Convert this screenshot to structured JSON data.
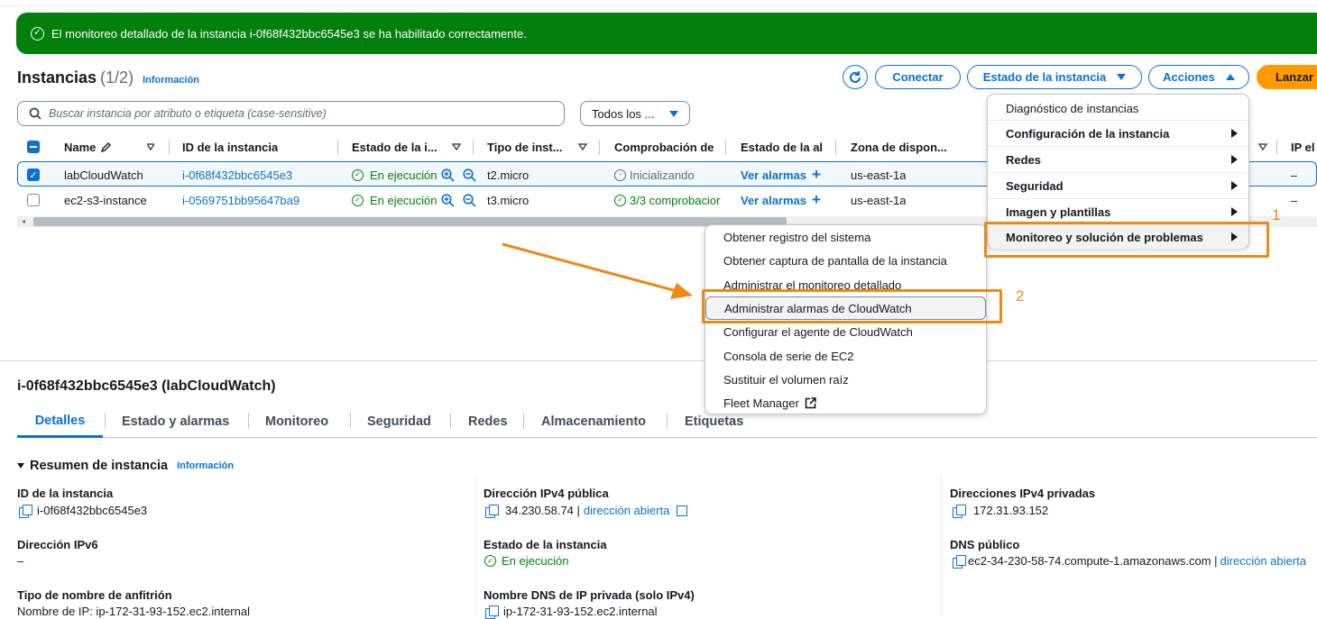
{
  "banner": {
    "text": "El monitoreo detallado de la instancia i-0f68f432bbc6545e3 se ha habilitado correctamente."
  },
  "header": {
    "title": "Instancias",
    "count": "(1/2)",
    "info": "Información"
  },
  "toolbar": {
    "refresh_icon": "refresh-icon",
    "connect": "Conectar",
    "instance_state": "Estado de la instancia",
    "actions": "Acciones",
    "launch": "Lanzar i"
  },
  "search": {
    "placeholder": "Buscar instancia por atributo o etiqueta (case-sensitive)"
  },
  "filter": {
    "value": "Todos los ..."
  },
  "table": {
    "headers": [
      "Name",
      "ID de la instancia",
      "Estado de la i...",
      "Tipo de inst...",
      "Comprobación de",
      "Estado de la al",
      "Zona de dispon...",
      "IP el"
    ],
    "rows": [
      {
        "name": "labCloudWatch",
        "id": "i-0f68f432bbc6545e3",
        "state": "En ejecución",
        "type": "t2.micro",
        "check": "Inicializando",
        "alarm": "Ver alarmas",
        "zone": "us-east-1a",
        "ip": "–",
        "selected": true
      },
      {
        "name": "ec2-s3-instance",
        "id": "i-0569751bb95647ba9",
        "state": "En ejecución",
        "type": "t3.micro",
        "check": "3/3 comprobacior",
        "alarm": "Ver alarmas",
        "zone": "us-east-1a",
        "ip": "–",
        "selected": false
      }
    ]
  },
  "actions_menu": [
    {
      "label": "Diagnóstico de instancias",
      "submenu": false,
      "bold": false
    },
    {
      "label": "Configuración de la instancia",
      "submenu": true,
      "bold": true
    },
    {
      "label": "Redes",
      "submenu": true,
      "bold": true
    },
    {
      "label": "Seguridad",
      "submenu": true,
      "bold": true
    },
    {
      "label": "Imagen y plantillas",
      "submenu": true,
      "bold": true
    },
    {
      "label": "Monitoreo y solución de problemas",
      "submenu": true,
      "bold": true
    }
  ],
  "submenu": [
    "Obtener registro del sistema",
    "Obtener captura de pantalla de la instancia",
    "Administrar el monitoreo detallado",
    "Administrar alarmas de CloudWatch",
    "Configurar el agente de CloudWatch",
    "Consola de serie de EC2",
    "Sustituir el volumen raíz",
    "Fleet Manager"
  ],
  "annotations": {
    "one": "1",
    "two": "2"
  },
  "details": {
    "title": "i-0f68f432bbc6545e3 (labCloudWatch)",
    "tabs": [
      "Detalles",
      "Estado y alarmas",
      "Monitoreo",
      "Seguridad",
      "Redes",
      "Almacenamiento",
      "Etiquetas"
    ],
    "summary": "Resumen de instancia",
    "summary_info": "Información",
    "fields": {
      "instance_id_label": "ID de la instancia",
      "instance_id": "i-0f68f432bbc6545e3",
      "ipv6_label": "Dirección IPv6",
      "ipv6": "–",
      "hostname_label": "Tipo de nombre de anfitrión",
      "hostname": "Nombre de IP: ip-172-31-93-152.ec2.internal",
      "public_ipv4_label": "Dirección IPv4 pública",
      "public_ipv4": "34.230.58.74 |",
      "open_address": "dirección abierta",
      "state_label": "Estado de la instancia",
      "state": "En ejecución",
      "private_dns_label": "Nombre DNS de IP privada (solo IPv4)",
      "private_dns": "ip-172-31-93-152.ec2.internal",
      "private_ipv4_label": "Direcciones IPv4 privadas",
      "private_ipv4": "172.31.93.152",
      "public_dns_label": "DNS público",
      "public_dns": "ec2-34-230-58-74.compute-1.amazonaws.com |",
      "public_dns_link": "dirección abierta"
    }
  },
  "colors": {
    "accent": "#0972d3",
    "success": "#037f0c",
    "highlight": "#ec8a13"
  }
}
